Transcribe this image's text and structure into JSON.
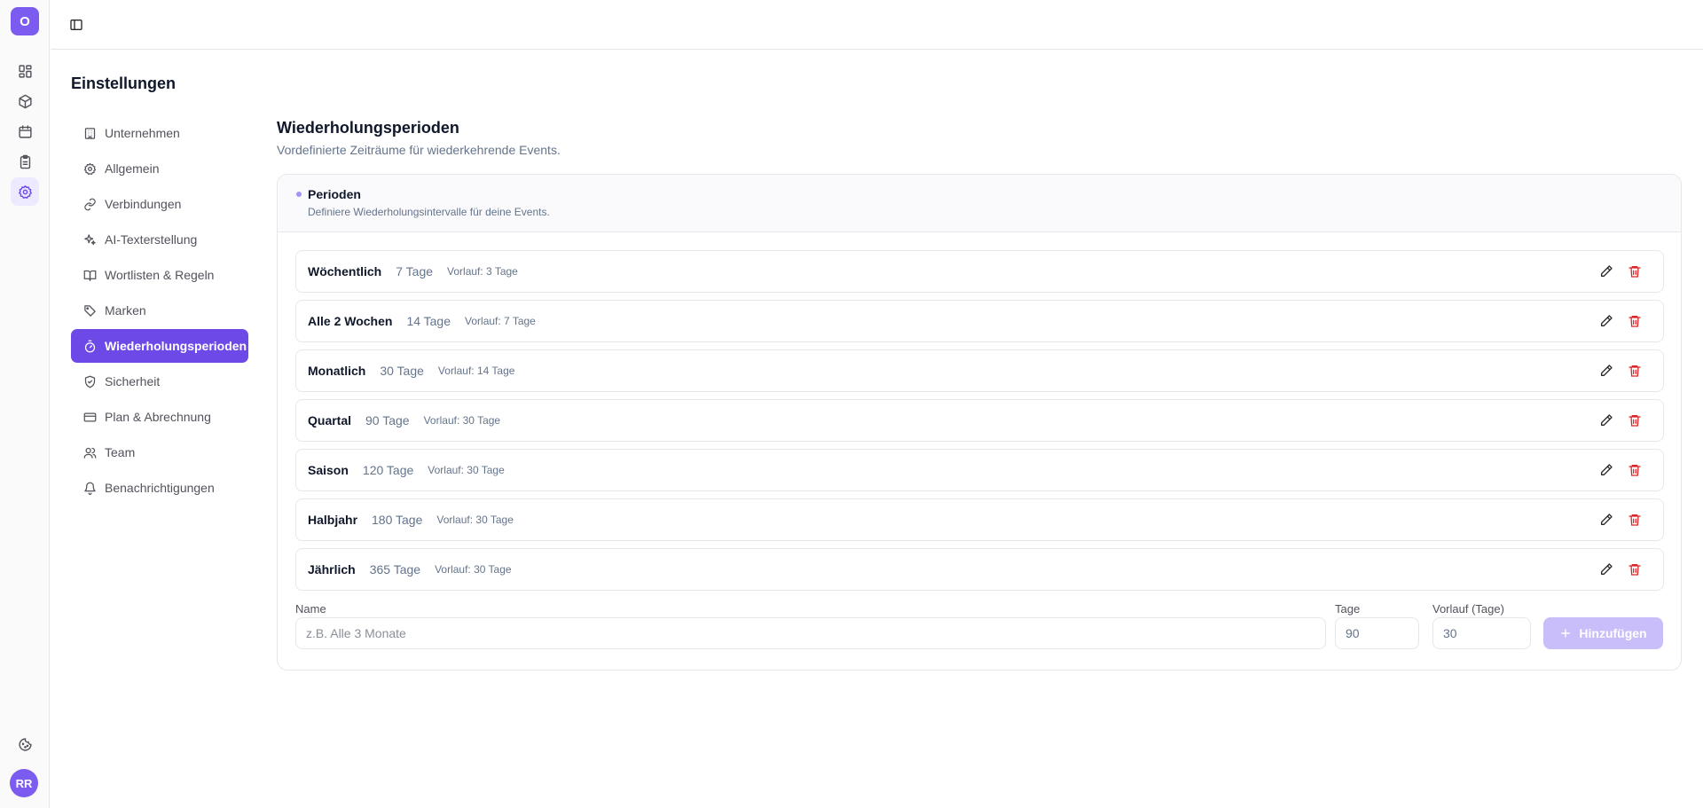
{
  "app": {
    "logo_letter": "O",
    "user_initials": "RR"
  },
  "page_title": "Einstellungen",
  "nav": {
    "items": [
      {
        "label": "Unternehmen",
        "icon": "building-icon"
      },
      {
        "label": "Allgemein",
        "icon": "gear-icon"
      },
      {
        "label": "Verbindungen",
        "icon": "link-icon"
      },
      {
        "label": "AI-Texterstellung",
        "icon": "sparkles-icon"
      },
      {
        "label": "Wortlisten & Regeln",
        "icon": "book-icon"
      },
      {
        "label": "Marken",
        "icon": "tag-icon"
      },
      {
        "label": "Wiederholungsperioden",
        "icon": "timer-icon",
        "active": true
      },
      {
        "label": "Sicherheit",
        "icon": "shield-icon"
      },
      {
        "label": "Plan & Abrechnung",
        "icon": "credit-card-icon"
      },
      {
        "label": "Team",
        "icon": "users-icon"
      },
      {
        "label": "Benachrichtigungen",
        "icon": "bell-icon"
      }
    ]
  },
  "section": {
    "title": "Wiederholungsperioden",
    "subtitle": "Vordefinierte Zeiträume für wiederkehrende Events."
  },
  "card": {
    "title": "Perioden",
    "description": "Definiere Wiederholungsintervalle für deine Events."
  },
  "periods": [
    {
      "name": "Wöchentlich",
      "days": "7 Tage",
      "lead": "Vorlauf: 3 Tage"
    },
    {
      "name": "Alle 2 Wochen",
      "days": "14 Tage",
      "lead": "Vorlauf: 7 Tage"
    },
    {
      "name": "Monatlich",
      "days": "30 Tage",
      "lead": "Vorlauf: 14 Tage"
    },
    {
      "name": "Quartal",
      "days": "90 Tage",
      "lead": "Vorlauf: 30 Tage"
    },
    {
      "name": "Saison",
      "days": "120 Tage",
      "lead": "Vorlauf: 30 Tage"
    },
    {
      "name": "Halbjahr",
      "days": "180 Tage",
      "lead": "Vorlauf: 30 Tage"
    },
    {
      "name": "Jährlich",
      "days": "365 Tage",
      "lead": "Vorlauf: 30 Tage"
    }
  ],
  "form": {
    "name_label": "Name",
    "name_placeholder": "z.B. Alle 3 Monate",
    "days_label": "Tage",
    "days_value": "90",
    "lead_label": "Vorlauf (Tage)",
    "lead_value": "30",
    "add_label": "Hinzufügen"
  },
  "colors": {
    "accent": "#6d4ae8",
    "danger": "#dc2626",
    "button_disabled": "#c9befa"
  }
}
